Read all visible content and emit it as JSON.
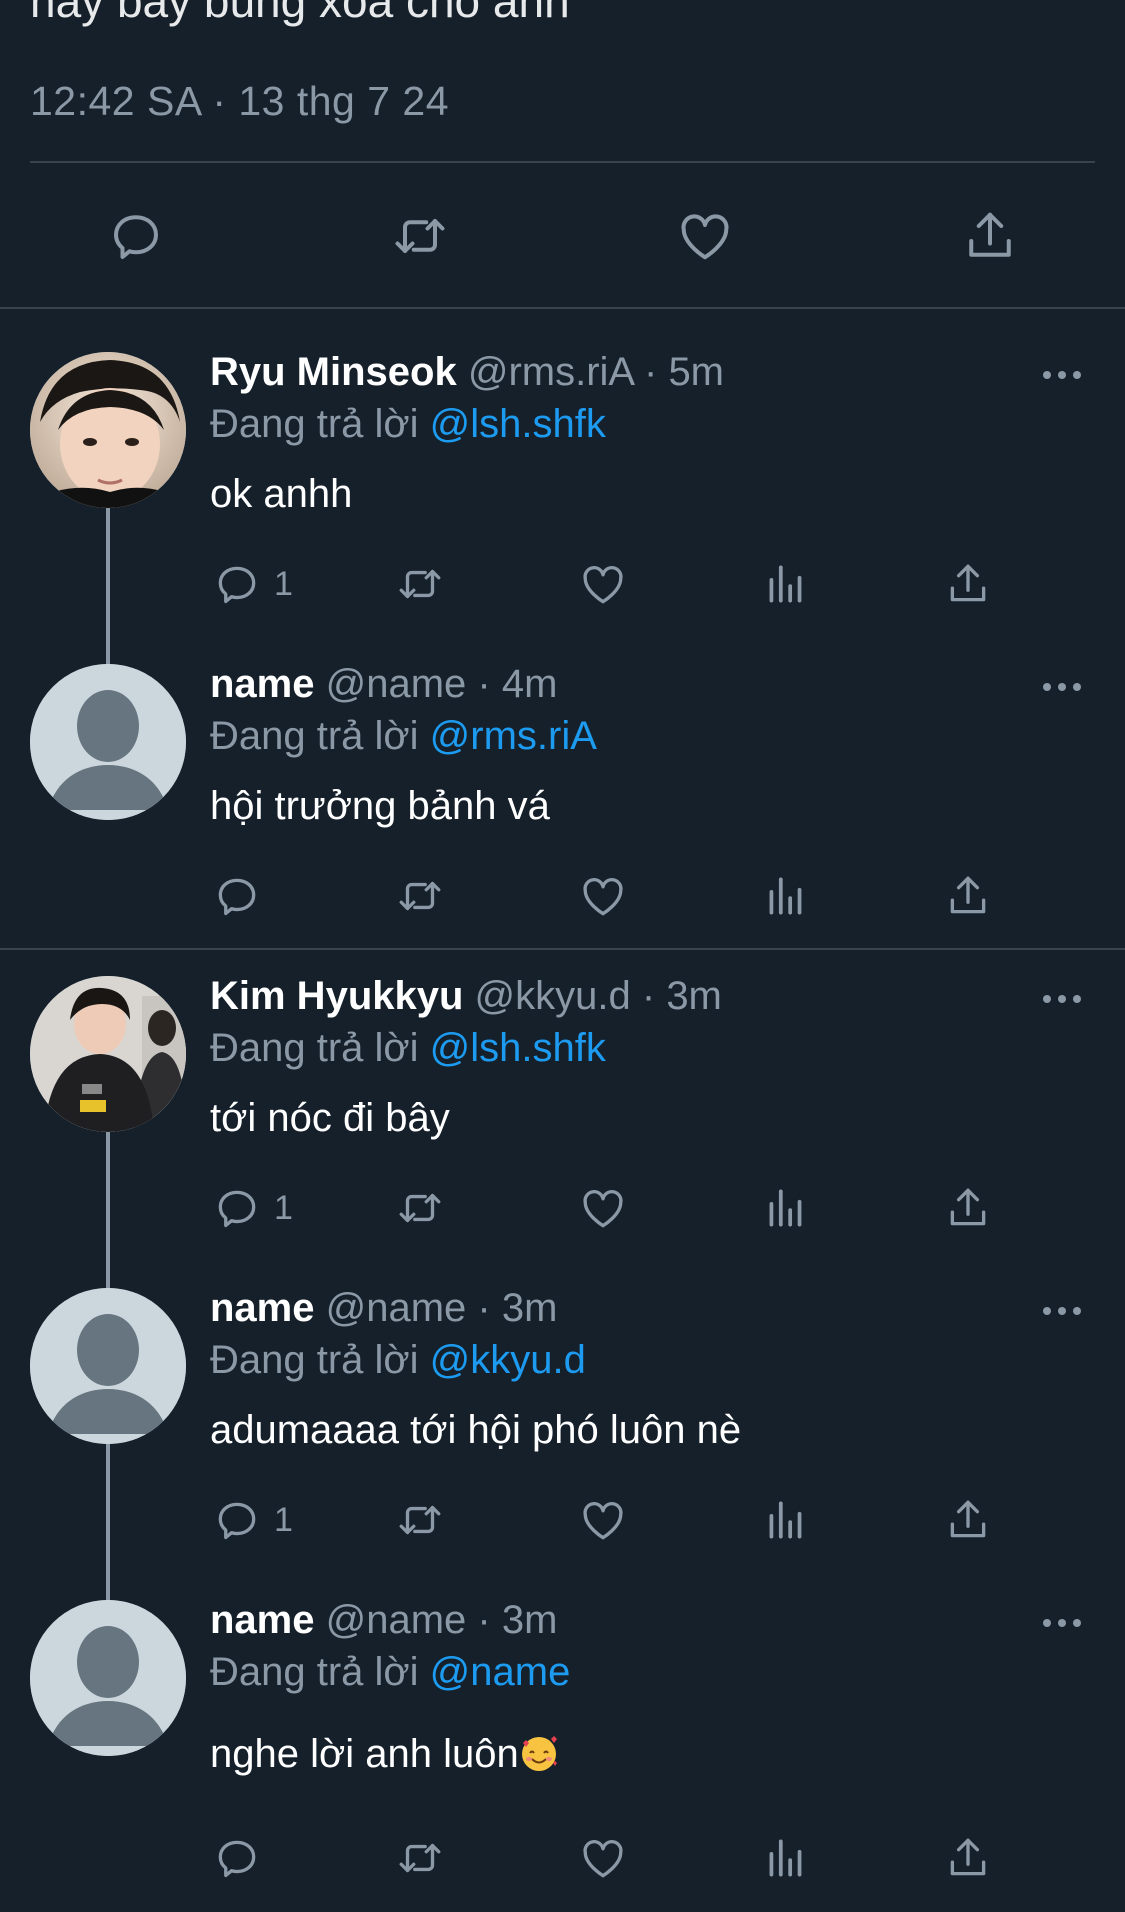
{
  "main_tweet": {
    "text_cut": "nay bay bùng xõa cho anh",
    "timestamp": "12:42 SA · 13 thg 7 24"
  },
  "icons": {
    "reply": "speech-bubble-icon",
    "retweet": "retweet-arrows-icon",
    "like": "heart-icon",
    "views": "bar-chart-icon",
    "share": "share-upload-icon",
    "more": "ellipsis-icon"
  },
  "colors": {
    "background": "#15202b",
    "divider": "#38444d",
    "muted": "#8b98a5",
    "mention": "#1d9bf0",
    "text": "#ffffff"
  },
  "replies": [
    {
      "display_name": "Ryu Minseok",
      "handle": "@rms.riA",
      "time": "5m",
      "replying_label": "Đang trả lời",
      "replying_to": "@lsh.shfk",
      "text": "ok anhh",
      "reply_count": "1",
      "avatar": "photo-face"
    },
    {
      "display_name": "name",
      "handle": "@name",
      "time": "4m",
      "replying_label": "Đang trả lời",
      "replying_to": "@rms.riA",
      "text": "hội trưởng bảnh vá",
      "reply_count": "",
      "avatar": "default"
    },
    {
      "display_name": "Kim Hyukkyu",
      "handle": "@kkyu.d",
      "time": "3m",
      "replying_label": "Đang trả lời",
      "replying_to": "@lsh.shfk",
      "text": "tới nóc đi bây",
      "reply_count": "1",
      "avatar": "photo-jacket"
    },
    {
      "display_name": "name",
      "handle": "@name",
      "time": "3m",
      "replying_label": "Đang trả lời",
      "replying_to": "@kkyu.d",
      "text": "adumaaaa tới hội phó luôn nè",
      "reply_count": "1",
      "avatar": "default"
    },
    {
      "display_name": "name",
      "handle": "@name",
      "time": "3m",
      "replying_label": "Đang trả lời",
      "replying_to": "@name",
      "text": "nghe lời anh luôn",
      "reply_count": "",
      "avatar": "default"
    }
  ]
}
